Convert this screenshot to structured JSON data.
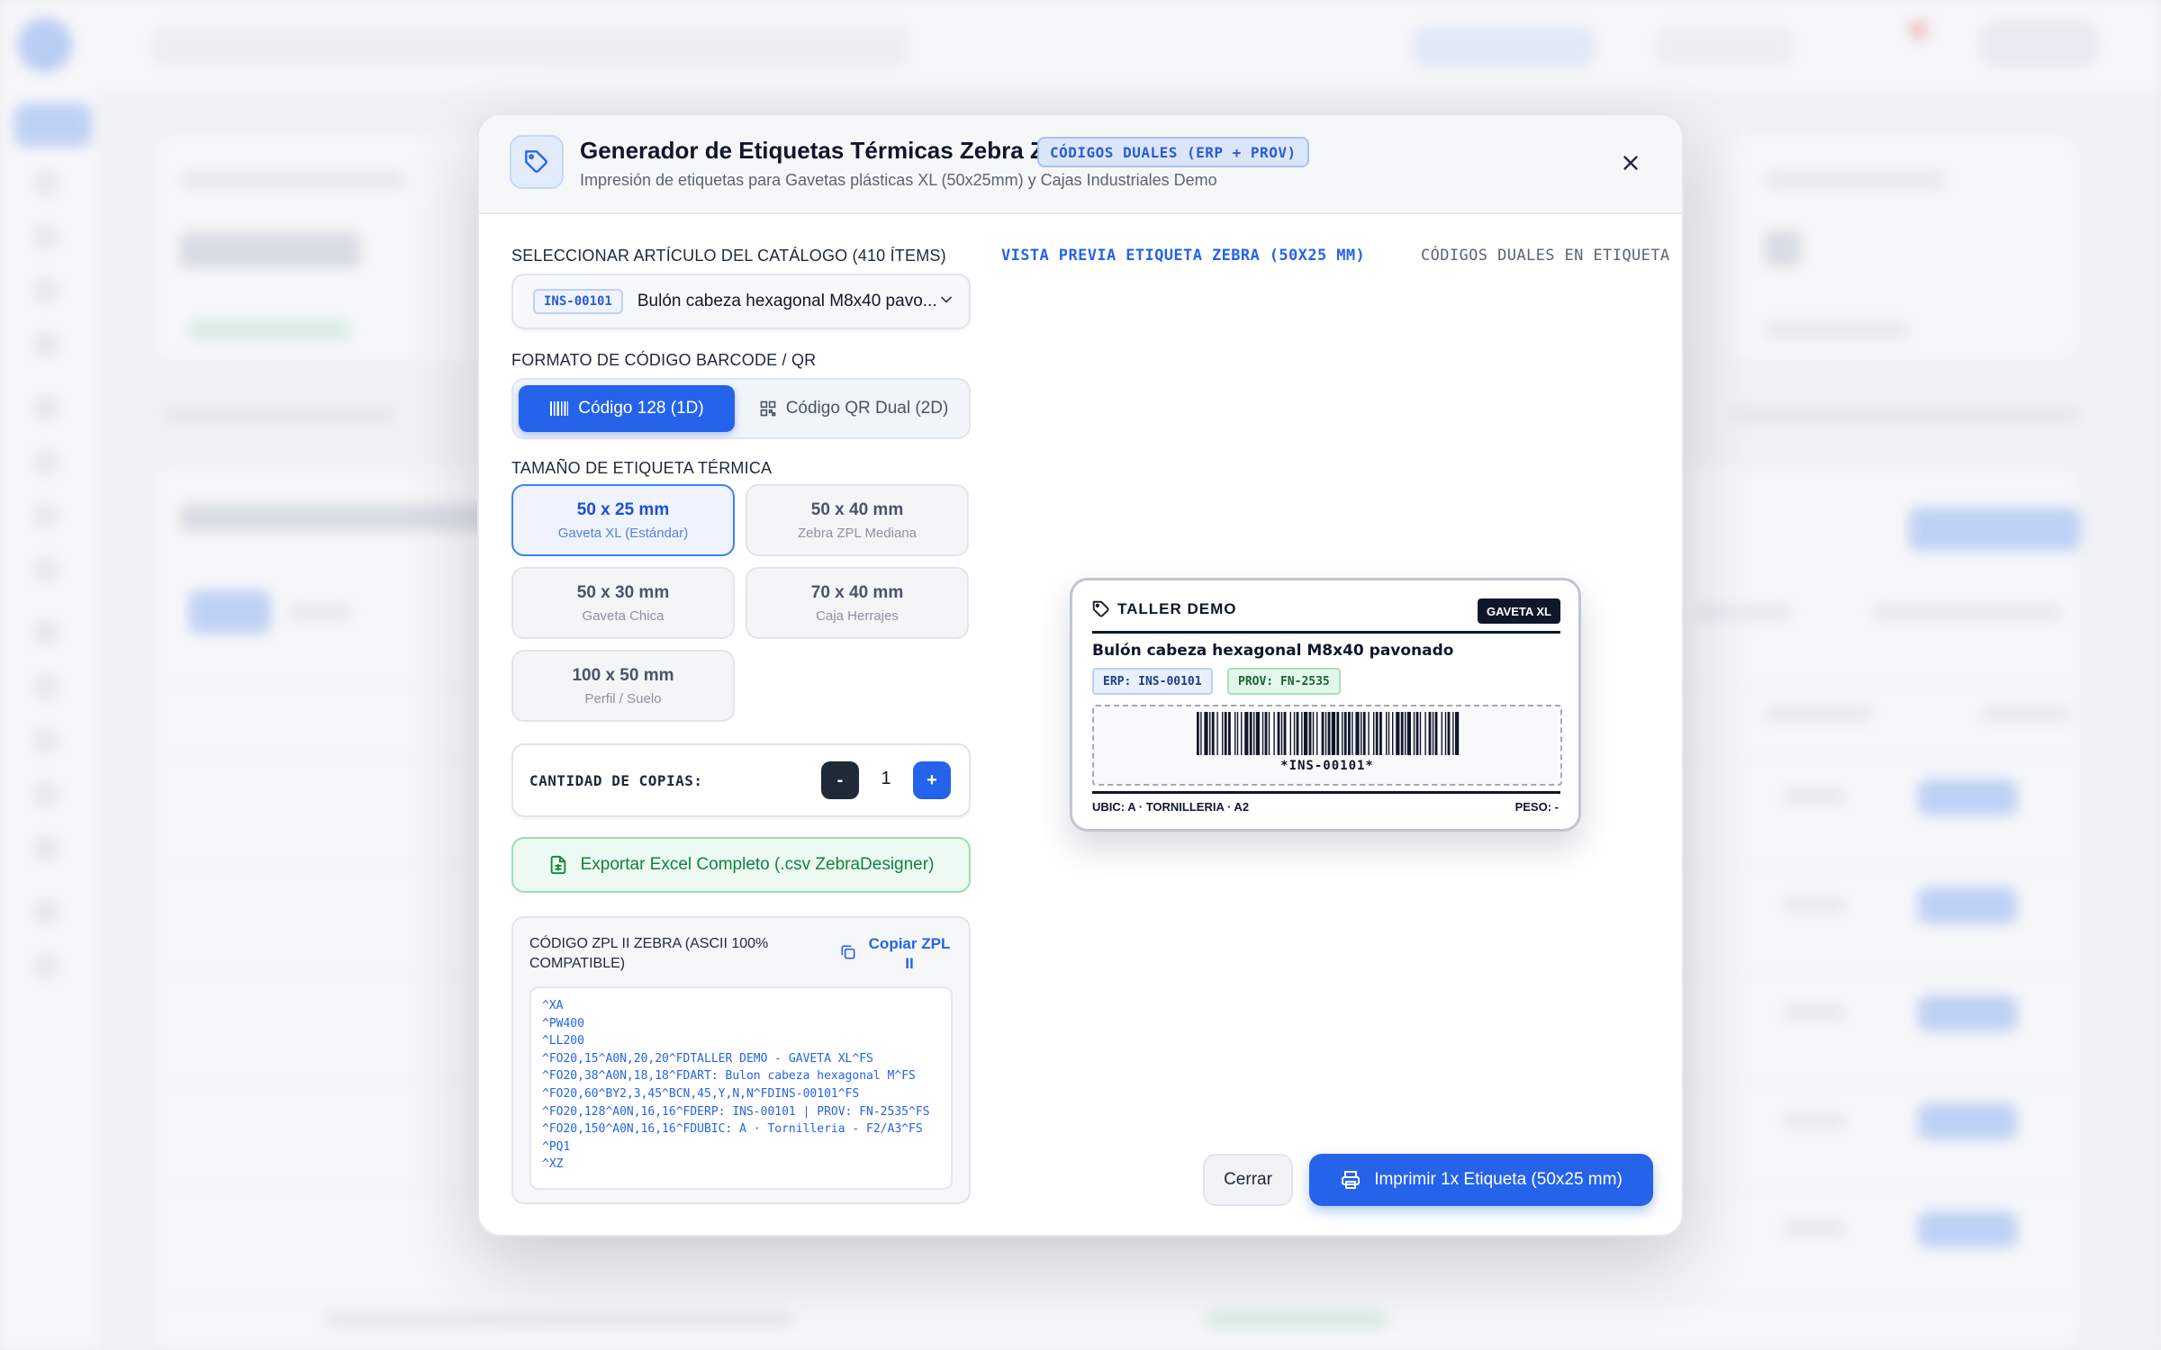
{
  "modal": {
    "title": "Generador de Etiquetas Térmicas Zebra ZPL II",
    "badge": "CÓDIGOS DUALES (ERP + PROV)",
    "subtitle": "Impresión de etiquetas para Gavetas plásticas XL (50x25mm) y Cajas Industriales Demo",
    "icon": "tag-icon",
    "close_icon": "close-icon"
  },
  "catalog": {
    "label": "SELECCIONAR ARTÍCULO DEL CATÁLOGO (410 ÍTEMS)",
    "selected_sku": "INS-00101",
    "selected_name": "Bulón cabeza hexagonal M8x40 pavo..."
  },
  "format": {
    "label": "FORMATO DE CÓDIGO BARCODE / QR",
    "options": [
      {
        "label": "Código 128 (1D)",
        "icon": "barcode-icon",
        "active": true
      },
      {
        "label": "Código QR Dual (2D)",
        "icon": "qr-code-icon",
        "active": false
      }
    ]
  },
  "size": {
    "label": "TAMAÑO DE ETIQUETA TÉRMICA",
    "options": [
      {
        "main": "50 x 25 mm",
        "sub": "Gaveta XL (Estándar)",
        "active": true
      },
      {
        "main": "50 x 40 mm",
        "sub": "Zebra ZPL Mediana",
        "active": false
      },
      {
        "main": "50 x 30 mm",
        "sub": "Gaveta Chica",
        "active": false
      },
      {
        "main": "70 x 40 mm",
        "sub": "Caja Herrajes",
        "active": false
      },
      {
        "main": "100 x 50 mm",
        "sub": "Perfil / Suelo",
        "active": false
      }
    ]
  },
  "copies": {
    "label": "CANTIDAD DE COPIAS:",
    "minus": "-",
    "value": "1",
    "plus": "+"
  },
  "export": {
    "label": "Exportar Excel Completo (.csv ZebraDesigner)",
    "icon": "spreadsheet-icon"
  },
  "zpl": {
    "title": "CÓDIGO ZPL II ZEBRA (ASCII 100% COMPATIBLE)",
    "copy_label": "Copiar ZPL II",
    "lines": [
      "^XA",
      "^PW400",
      "^LL200",
      "^FO20,15^A0N,20,20^FDTALLER DEMO - GAVETA XL^FS",
      "^FO20,38^A0N,18,18^FDART: Bulon cabeza hexagonal M^FS",
      "^FO20,60^BY2,3,45^BCN,45,Y,N,N^FDINS-00101^FS",
      "^FO20,128^A0N,16,16^FDERP: INS-00101 | PROV: FN-2535^FS",
      "^FO20,150^A0N,16,16^FDUBIC: A · Tornilleria - F2/A3^FS",
      "^PQ1",
      "^XZ"
    ]
  },
  "preview": {
    "title": "VISTA PREVIA ETIQUETA ZEBRA (50X25 MM)",
    "dual_label": "CÓDIGOS DUALES EN ETIQUETA",
    "label": {
      "brand": "TALLER DEMO",
      "badge": "GAVETA XL",
      "name": "Bulón cabeza hexagonal M8x40 pavonado",
      "erp": "ERP: INS-00101",
      "prov": "PROV: FN-2535",
      "barcode_text": "*INS-00101*",
      "location": "UBIC: A · TORNILLERIA · A2",
      "weight": "PESO: -"
    }
  },
  "actions": {
    "close": "Cerrar",
    "print": "Imprimir 1x Etiqueta (50x25 mm)",
    "print_icon": "printer-icon"
  },
  "colors": {
    "primary": "#2563eb",
    "success": "#15803d",
    "dark": "#0f172a"
  }
}
